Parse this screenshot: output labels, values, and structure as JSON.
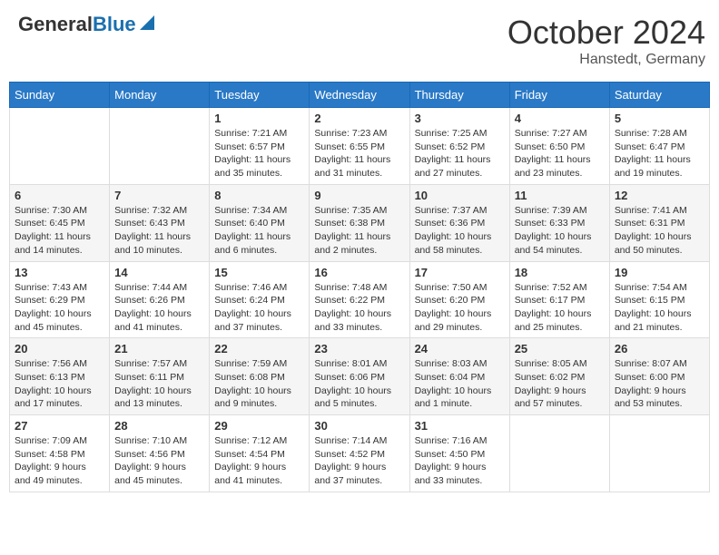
{
  "header": {
    "logo_general": "General",
    "logo_blue": "Blue",
    "month_year": "October 2024",
    "location": "Hanstedt, Germany"
  },
  "weekdays": [
    "Sunday",
    "Monday",
    "Tuesday",
    "Wednesday",
    "Thursday",
    "Friday",
    "Saturday"
  ],
  "weeks": [
    [
      {
        "day": "",
        "sunrise": "",
        "sunset": "",
        "daylight": ""
      },
      {
        "day": "",
        "sunrise": "",
        "sunset": "",
        "daylight": ""
      },
      {
        "day": "1",
        "sunrise": "Sunrise: 7:21 AM",
        "sunset": "Sunset: 6:57 PM",
        "daylight": "Daylight: 11 hours and 35 minutes."
      },
      {
        "day": "2",
        "sunrise": "Sunrise: 7:23 AM",
        "sunset": "Sunset: 6:55 PM",
        "daylight": "Daylight: 11 hours and 31 minutes."
      },
      {
        "day": "3",
        "sunrise": "Sunrise: 7:25 AM",
        "sunset": "Sunset: 6:52 PM",
        "daylight": "Daylight: 11 hours and 27 minutes."
      },
      {
        "day": "4",
        "sunrise": "Sunrise: 7:27 AM",
        "sunset": "Sunset: 6:50 PM",
        "daylight": "Daylight: 11 hours and 23 minutes."
      },
      {
        "day": "5",
        "sunrise": "Sunrise: 7:28 AM",
        "sunset": "Sunset: 6:47 PM",
        "daylight": "Daylight: 11 hours and 19 minutes."
      }
    ],
    [
      {
        "day": "6",
        "sunrise": "Sunrise: 7:30 AM",
        "sunset": "Sunset: 6:45 PM",
        "daylight": "Daylight: 11 hours and 14 minutes."
      },
      {
        "day": "7",
        "sunrise": "Sunrise: 7:32 AM",
        "sunset": "Sunset: 6:43 PM",
        "daylight": "Daylight: 11 hours and 10 minutes."
      },
      {
        "day": "8",
        "sunrise": "Sunrise: 7:34 AM",
        "sunset": "Sunset: 6:40 PM",
        "daylight": "Daylight: 11 hours and 6 minutes."
      },
      {
        "day": "9",
        "sunrise": "Sunrise: 7:35 AM",
        "sunset": "Sunset: 6:38 PM",
        "daylight": "Daylight: 11 hours and 2 minutes."
      },
      {
        "day": "10",
        "sunrise": "Sunrise: 7:37 AM",
        "sunset": "Sunset: 6:36 PM",
        "daylight": "Daylight: 10 hours and 58 minutes."
      },
      {
        "day": "11",
        "sunrise": "Sunrise: 7:39 AM",
        "sunset": "Sunset: 6:33 PM",
        "daylight": "Daylight: 10 hours and 54 minutes."
      },
      {
        "day": "12",
        "sunrise": "Sunrise: 7:41 AM",
        "sunset": "Sunset: 6:31 PM",
        "daylight": "Daylight: 10 hours and 50 minutes."
      }
    ],
    [
      {
        "day": "13",
        "sunrise": "Sunrise: 7:43 AM",
        "sunset": "Sunset: 6:29 PM",
        "daylight": "Daylight: 10 hours and 45 minutes."
      },
      {
        "day": "14",
        "sunrise": "Sunrise: 7:44 AM",
        "sunset": "Sunset: 6:26 PM",
        "daylight": "Daylight: 10 hours and 41 minutes."
      },
      {
        "day": "15",
        "sunrise": "Sunrise: 7:46 AM",
        "sunset": "Sunset: 6:24 PM",
        "daylight": "Daylight: 10 hours and 37 minutes."
      },
      {
        "day": "16",
        "sunrise": "Sunrise: 7:48 AM",
        "sunset": "Sunset: 6:22 PM",
        "daylight": "Daylight: 10 hours and 33 minutes."
      },
      {
        "day": "17",
        "sunrise": "Sunrise: 7:50 AM",
        "sunset": "Sunset: 6:20 PM",
        "daylight": "Daylight: 10 hours and 29 minutes."
      },
      {
        "day": "18",
        "sunrise": "Sunrise: 7:52 AM",
        "sunset": "Sunset: 6:17 PM",
        "daylight": "Daylight: 10 hours and 25 minutes."
      },
      {
        "day": "19",
        "sunrise": "Sunrise: 7:54 AM",
        "sunset": "Sunset: 6:15 PM",
        "daylight": "Daylight: 10 hours and 21 minutes."
      }
    ],
    [
      {
        "day": "20",
        "sunrise": "Sunrise: 7:56 AM",
        "sunset": "Sunset: 6:13 PM",
        "daylight": "Daylight: 10 hours and 17 minutes."
      },
      {
        "day": "21",
        "sunrise": "Sunrise: 7:57 AM",
        "sunset": "Sunset: 6:11 PM",
        "daylight": "Daylight: 10 hours and 13 minutes."
      },
      {
        "day": "22",
        "sunrise": "Sunrise: 7:59 AM",
        "sunset": "Sunset: 6:08 PM",
        "daylight": "Daylight: 10 hours and 9 minutes."
      },
      {
        "day": "23",
        "sunrise": "Sunrise: 8:01 AM",
        "sunset": "Sunset: 6:06 PM",
        "daylight": "Daylight: 10 hours and 5 minutes."
      },
      {
        "day": "24",
        "sunrise": "Sunrise: 8:03 AM",
        "sunset": "Sunset: 6:04 PM",
        "daylight": "Daylight: 10 hours and 1 minute."
      },
      {
        "day": "25",
        "sunrise": "Sunrise: 8:05 AM",
        "sunset": "Sunset: 6:02 PM",
        "daylight": "Daylight: 9 hours and 57 minutes."
      },
      {
        "day": "26",
        "sunrise": "Sunrise: 8:07 AM",
        "sunset": "Sunset: 6:00 PM",
        "daylight": "Daylight: 9 hours and 53 minutes."
      }
    ],
    [
      {
        "day": "27",
        "sunrise": "Sunrise: 7:09 AM",
        "sunset": "Sunset: 4:58 PM",
        "daylight": "Daylight: 9 hours and 49 minutes."
      },
      {
        "day": "28",
        "sunrise": "Sunrise: 7:10 AM",
        "sunset": "Sunset: 4:56 PM",
        "daylight": "Daylight: 9 hours and 45 minutes."
      },
      {
        "day": "29",
        "sunrise": "Sunrise: 7:12 AM",
        "sunset": "Sunset: 4:54 PM",
        "daylight": "Daylight: 9 hours and 41 minutes."
      },
      {
        "day": "30",
        "sunrise": "Sunrise: 7:14 AM",
        "sunset": "Sunset: 4:52 PM",
        "daylight": "Daylight: 9 hours and 37 minutes."
      },
      {
        "day": "31",
        "sunrise": "Sunrise: 7:16 AM",
        "sunset": "Sunset: 4:50 PM",
        "daylight": "Daylight: 9 hours and 33 minutes."
      },
      {
        "day": "",
        "sunrise": "",
        "sunset": "",
        "daylight": ""
      },
      {
        "day": "",
        "sunrise": "",
        "sunset": "",
        "daylight": ""
      }
    ]
  ]
}
